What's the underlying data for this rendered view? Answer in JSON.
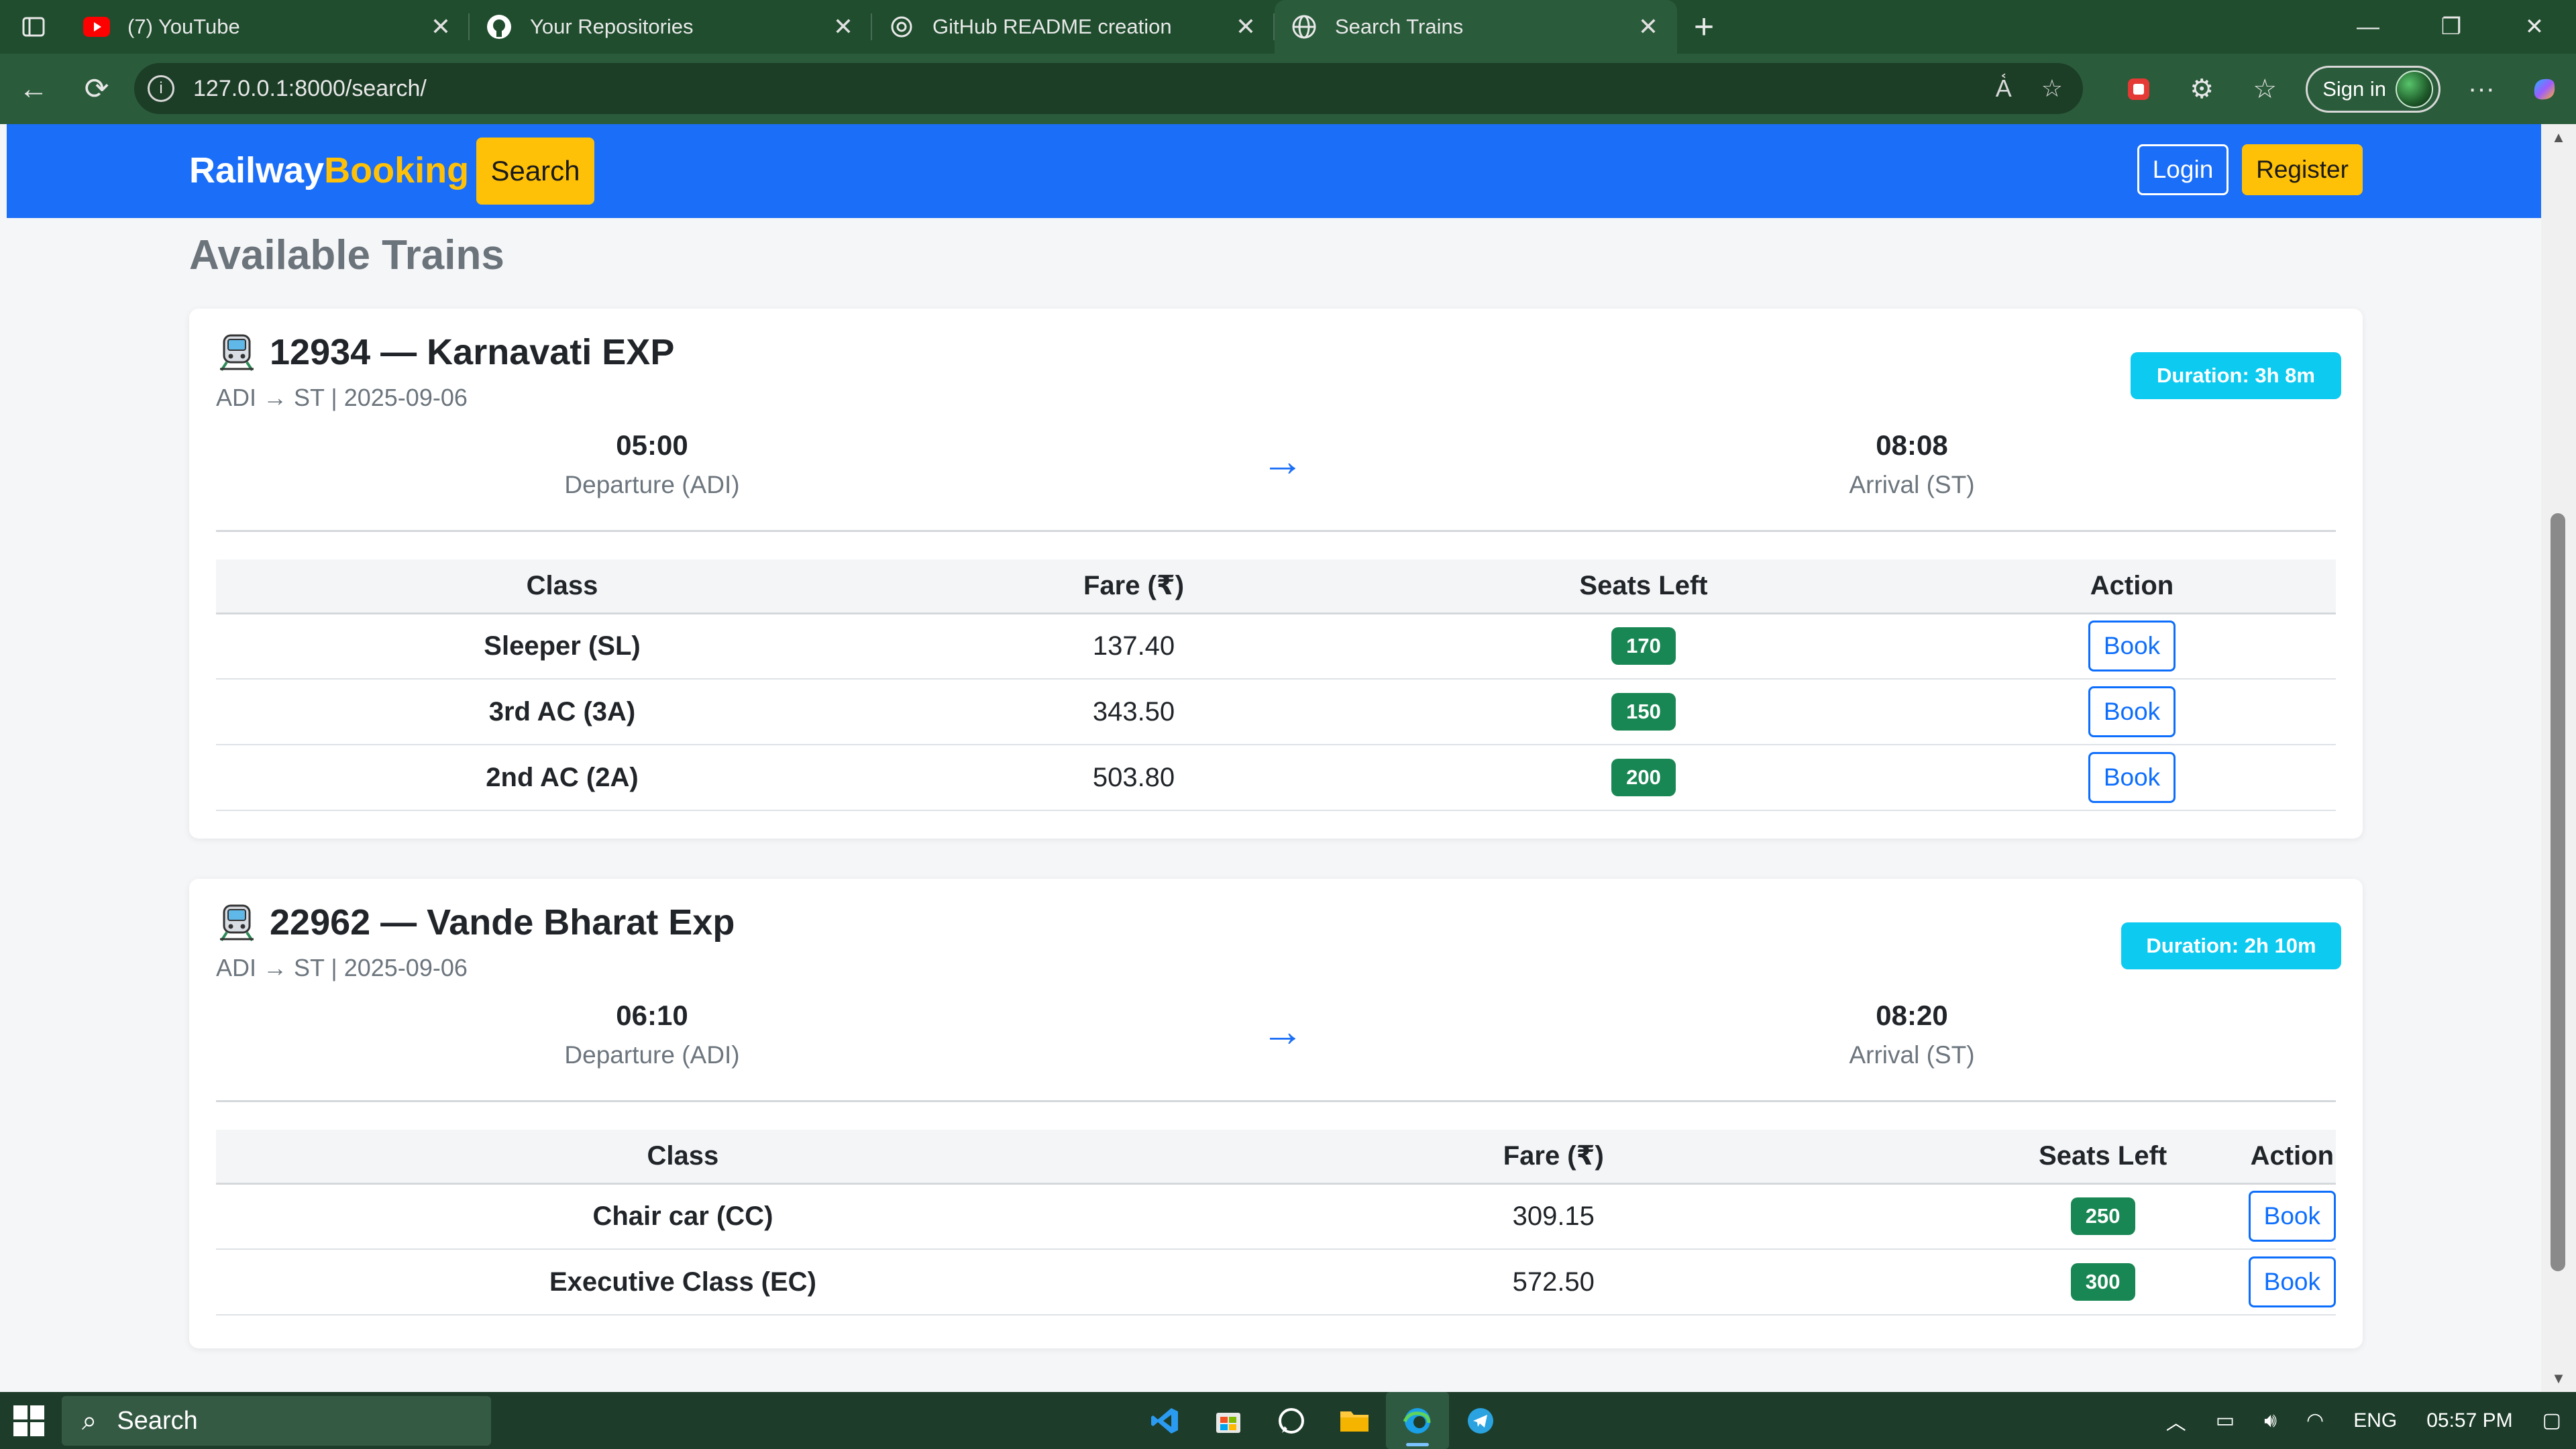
{
  "browser": {
    "tabs": [
      {
        "title": "(7) YouTube",
        "icon": "youtube-icon",
        "active": false
      },
      {
        "title": "Your Repositories",
        "icon": "github-icon",
        "active": false
      },
      {
        "title": "GitHub README creation",
        "icon": "chatgpt-icon",
        "active": false
      },
      {
        "title": "Search Trains",
        "icon": "globe-icon",
        "active": true
      }
    ],
    "url": "127.0.0.1:8000/search/",
    "sign_in_label": "Sign in"
  },
  "navbar": {
    "brand_primary": "Railway",
    "brand_accent": "Booking",
    "search_label": "Search",
    "login_label": "Login",
    "register_label": "Register"
  },
  "page": {
    "heading": "Available Trains"
  },
  "trains": [
    {
      "title": "12934 — Karnavati EXP",
      "route": "ADI → ST | 2025-09-06",
      "duration": "Duration: 3h 8m",
      "departure_time": "05:00",
      "departure_label": "Departure (ADI)",
      "arrival_time": "08:08",
      "arrival_label": "Arrival (ST)",
      "columns": [
        "Class",
        "Fare (₹)",
        "Seats Left",
        "Action"
      ],
      "classes": [
        {
          "name": "Sleeper (SL)",
          "fare": "137.40",
          "seats": "170",
          "action": "Book"
        },
        {
          "name": "3rd AC (3A)",
          "fare": "343.50",
          "seats": "150",
          "action": "Book"
        },
        {
          "name": "2nd AC (2A)",
          "fare": "503.80",
          "seats": "200",
          "action": "Book"
        }
      ]
    },
    {
      "title": "22962 — Vande Bharat Exp",
      "route": "ADI → ST | 2025-09-06",
      "duration": "Duration: 2h 10m",
      "departure_time": "06:10",
      "departure_label": "Departure (ADI)",
      "arrival_time": "08:20",
      "arrival_label": "Arrival (ST)",
      "columns": [
        "Class",
        "Fare (₹)",
        "Seats Left",
        "Action"
      ],
      "classes": [
        {
          "name": "Chair car (CC)",
          "fare": "309.15",
          "seats": "250",
          "action": "Book"
        },
        {
          "name": "Executive Class (EC)",
          "fare": "572.50",
          "seats": "300",
          "action": "Book"
        }
      ]
    }
  ],
  "taskbar": {
    "search_label": "Search",
    "language": "ENG",
    "time": "05:57 PM"
  },
  "colors": {
    "navbar": "#1a6ef7",
    "accent_yellow": "#ffc107",
    "duration_badge": "#0dcaf0",
    "seats_badge": "#198754",
    "book_button": "#0d6efd"
  }
}
